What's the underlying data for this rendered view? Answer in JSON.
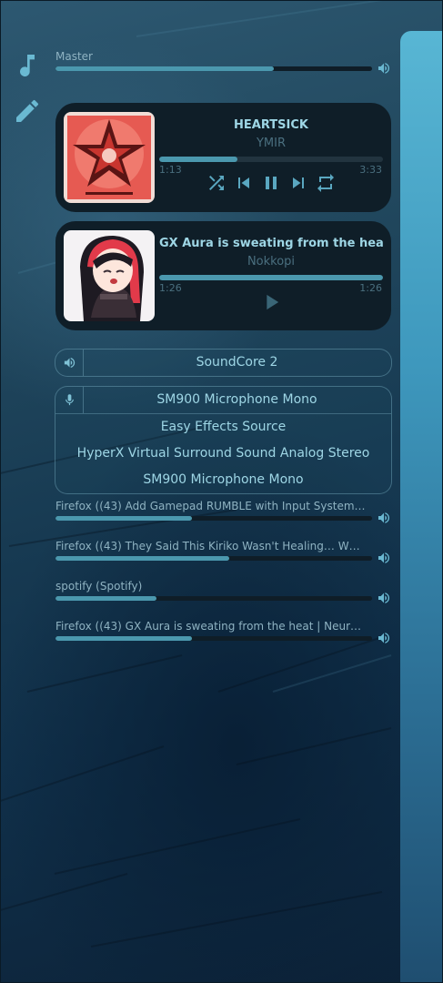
{
  "master": {
    "label": "Master",
    "level": 0.69
  },
  "players": [
    {
      "title": "HEARTSICK",
      "artist": "YMIR",
      "elapsed": "1:13",
      "duration": "3:33",
      "progress": 0.35
    },
    {
      "title": "GX Aura is sweating from the heat | ...",
      "artist": "Nokkopi",
      "elapsed": "1:26",
      "duration": "1:26",
      "progress": 1.0
    }
  ],
  "output": {
    "device": "SoundCore 2"
  },
  "input": {
    "devices": [
      "SM900 Microphone  Mono",
      "Easy Effects Source",
      "HyperX Virtual Surround Sound Analog Stereo",
      "SM900 Microphone  Mono"
    ]
  },
  "streams": [
    {
      "label": "Firefox ((43) Add Gamepad RUMBLE with Input System…",
      "level": 0.43
    },
    {
      "label": "Firefox ((43) They Said This Kiriko Wasn't Healing… W…",
      "level": 0.55
    },
    {
      "label": "spotify (Spotify)",
      "level": 0.32
    },
    {
      "label": "Firefox ((43) GX Aura is sweating from the heat | Neur…",
      "level": 0.43
    }
  ],
  "icons": {
    "side": [
      "music-note-icon",
      "pencil-icon"
    ],
    "controls": [
      "shuffle-icon",
      "skip-previous-icon",
      "pause-icon",
      "skip-next-icon",
      "repeat-icon"
    ],
    "play": "play-icon",
    "volume": "speaker-icon",
    "microphone": "microphone-icon"
  },
  "colors": {
    "accent": "#4b98ae",
    "track": "#0f1d27",
    "card": "#0f1e28",
    "text": "#9ed6e5"
  }
}
